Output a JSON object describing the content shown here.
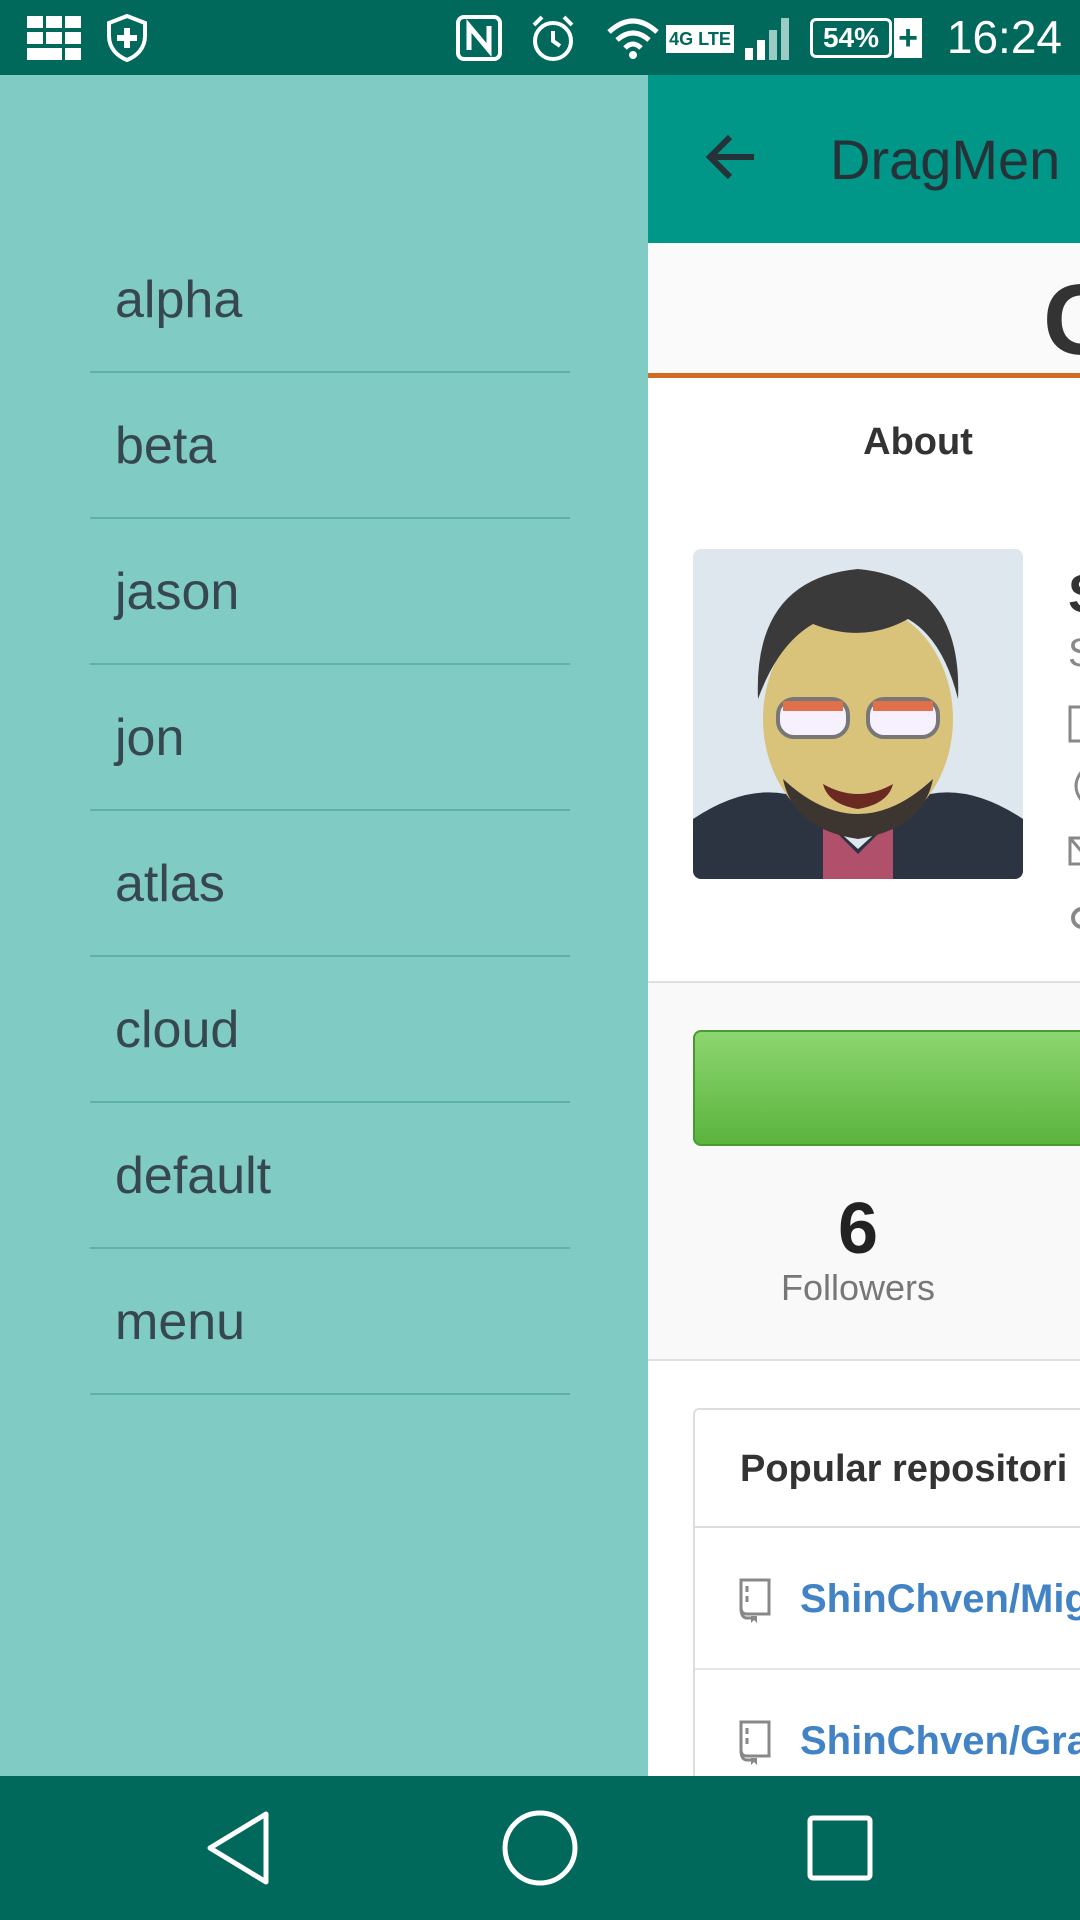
{
  "status_bar": {
    "time": "16:24",
    "battery": "54%",
    "battery_charging": "+",
    "network": "4G LTE",
    "icons": [
      "apps-grid-icon",
      "shield-plus-icon",
      "nfc-icon",
      "alarm-icon",
      "wifi-icon",
      "lte-icon",
      "signal-icon",
      "battery-icon"
    ]
  },
  "app_bar": {
    "title": "DragMen",
    "back_icon": "arrow-back-icon"
  },
  "drawer": {
    "items": [
      {
        "label": "alpha"
      },
      {
        "label": "beta"
      },
      {
        "label": "jason"
      },
      {
        "label": "jon"
      },
      {
        "label": "atlas"
      },
      {
        "label": "cloud"
      },
      {
        "label": "default"
      },
      {
        "label": "menu"
      }
    ]
  },
  "profile": {
    "logo_fragment": "G",
    "tab_label": "About",
    "side_fragments": [
      "S",
      "S"
    ],
    "followers_count": "6",
    "followers_label": "Followers",
    "follow_button_color": "#6cc24a"
  },
  "repositories": {
    "header": "Popular repositori",
    "items": [
      {
        "name": "ShinChven/Mig"
      },
      {
        "name": "ShinChven/Gra"
      }
    ]
  },
  "nav_bar": {
    "buttons": [
      "back-triangle-icon",
      "home-circle-icon",
      "recents-square-icon"
    ]
  },
  "colors": {
    "status_bar": "#00695c",
    "app_bar": "#009688",
    "drawer": "#80cbc4",
    "accent_line": "#d26b24",
    "link": "#4183c4"
  }
}
